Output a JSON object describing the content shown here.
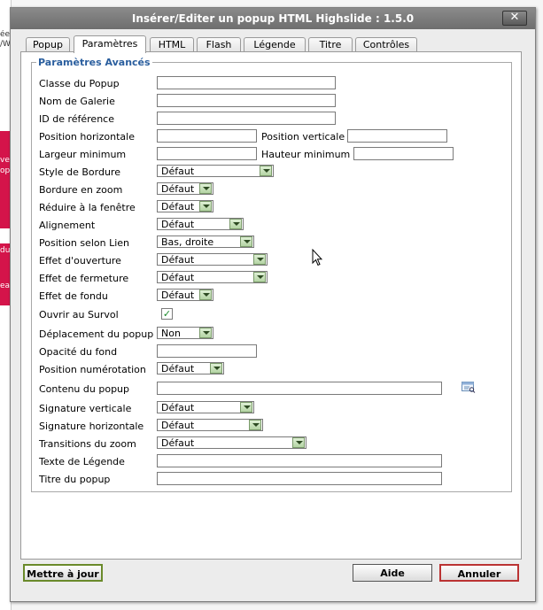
{
  "window": {
    "title": "Insérer/Editer un popup HTML Highslide : 1.5.0",
    "close_label": "✕"
  },
  "background": {
    "snippets": [
      "ée",
      "/W",
      "ve",
      "op",
      "du",
      "eat"
    ]
  },
  "tabs": [
    {
      "label": "Popup"
    },
    {
      "label": "Paramètres"
    },
    {
      "label": "HTML"
    },
    {
      "label": "Flash"
    },
    {
      "label": "Légende"
    },
    {
      "label": "Titre"
    },
    {
      "label": "Contrôles"
    }
  ],
  "section": {
    "legend": "Paramètres Avancés"
  },
  "fields": {
    "classe": {
      "label": "Classe du Popup",
      "value": ""
    },
    "galerie": {
      "label": "Nom de Galerie",
      "value": ""
    },
    "id_ref": {
      "label": "ID de référence",
      "value": ""
    },
    "pos_h": {
      "label": "Position horizontale",
      "value": ""
    },
    "pos_v": {
      "label": "Position verticale",
      "value": ""
    },
    "largeur": {
      "label": "Largeur minimum",
      "value": ""
    },
    "hauteur": {
      "label": "Hauteur minimum",
      "value": ""
    },
    "bordure_style": {
      "label": "Style de Bordure",
      "value": "Défaut"
    },
    "bordure_zoom": {
      "label": "Bordure en zoom",
      "value": "Défaut"
    },
    "reduire": {
      "label": "Réduire à la fenêtre",
      "value": "Défaut"
    },
    "alignement": {
      "label": "Alignement",
      "value": "Défaut"
    },
    "position_lien": {
      "label": "Position selon Lien",
      "value": "Bas, droite"
    },
    "effet_ouverture": {
      "label": "Effet d'ouverture",
      "value": "Défaut"
    },
    "effet_fermeture": {
      "label": "Effet de fermeture",
      "value": "Défaut"
    },
    "effet_fondu": {
      "label": "Effet de fondu",
      "value": "Défaut"
    },
    "ouvrir_survol": {
      "label": "Ouvrir au Survol",
      "checked": true,
      "mark": "✓"
    },
    "deplacement": {
      "label": "Déplacement du popup",
      "value": "Non"
    },
    "opacite": {
      "label": "Opacité du fond",
      "value": ""
    },
    "numerotation": {
      "label": "Position numérotation",
      "value": "Défaut"
    },
    "contenu": {
      "label": "Contenu du popup",
      "value": ""
    },
    "sig_v": {
      "label": "Signature verticale",
      "value": "Défaut"
    },
    "sig_h": {
      "label": "Signature horizontale",
      "value": "Défaut"
    },
    "transitions": {
      "label": "Transitions du zoom",
      "value": "Défaut"
    },
    "texte_legende": {
      "label": "Texte de Légende",
      "value": ""
    },
    "titre_popup": {
      "label": "Titre du popup",
      "value": ""
    }
  },
  "buttons": {
    "update": "Mettre à jour",
    "help": "Aide",
    "cancel": "Annuler"
  },
  "colors": {
    "legend": "#2a5e9e",
    "titlebar": "#7a7a7a",
    "cancel_border": "#b33333",
    "update_border": "#6a8a2a"
  }
}
